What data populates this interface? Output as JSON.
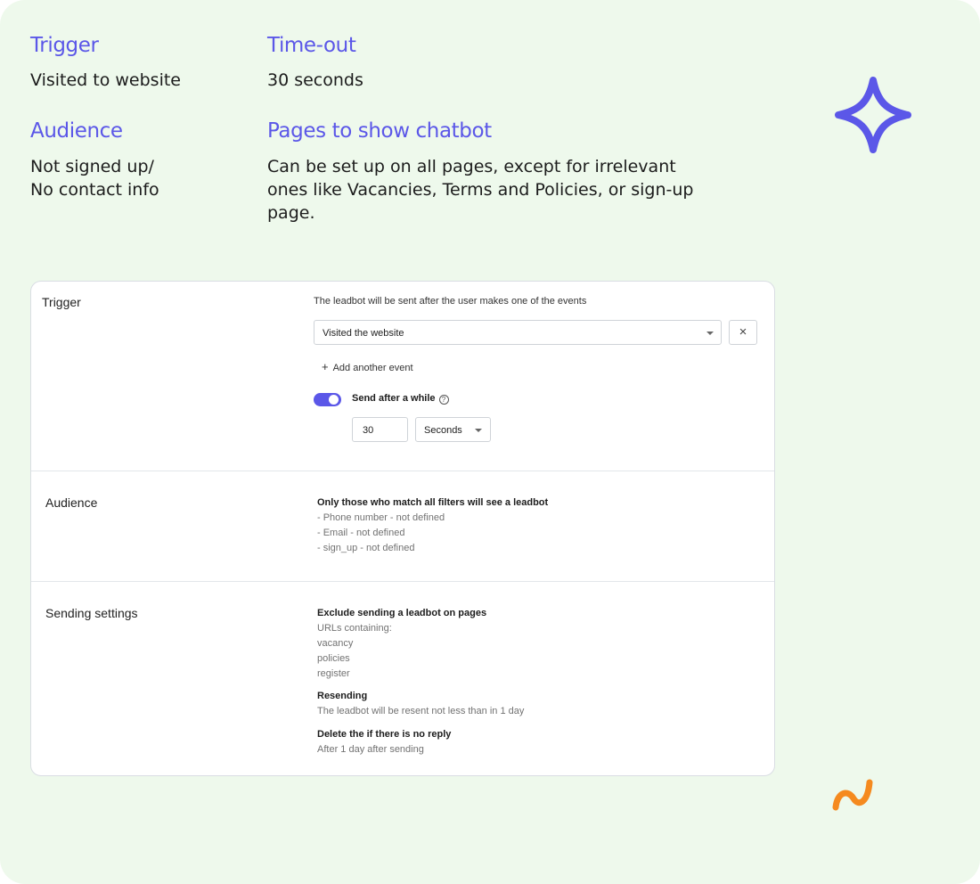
{
  "summary": {
    "trigger": {
      "heading": "Trigger",
      "value": "Visited to website"
    },
    "timeout": {
      "heading": "Time-out",
      "value": "30 seconds"
    },
    "audience": {
      "heading": "Audience",
      "value": "Not signed up/\nNo contact info"
    },
    "pages": {
      "heading": "Pages to show chatbot",
      "value": "Can be set up on all pages, except for irrelevant\nones like Vacancies, Terms and Policies, or sign-up\npage."
    }
  },
  "decor": {
    "sparkle_icon": "four-point-star-icon",
    "squiggle_icon": "squiggle-icon",
    "accent": "#5b57e8",
    "orange": "#f58a1f"
  },
  "card": {
    "trigger": {
      "label": "Trigger",
      "description": "The leadbot will be sent after the user makes one of the events",
      "event_value": "Visited the website",
      "remove_icon": "×",
      "add_event": "Add another event",
      "send_after_label": "Send after a while",
      "send_after_enabled": true,
      "delay_value": "30",
      "delay_unit": "Seconds"
    },
    "audience": {
      "label": "Audience",
      "title": "Only those who match all filters will see a leadbot",
      "filters": [
        "- Phone number - not defined",
        "- Email - not defined",
        "- sign_up - not defined"
      ]
    },
    "sending": {
      "label": "Sending settings",
      "exclude_title": "Exclude sending a leadbot on pages",
      "exclude_subtitle": "URLs containing:",
      "urls": [
        "vacancy",
        "policies",
        "register"
      ],
      "resend_title": "Resending",
      "resend_text": "The leadbot will be resent not less than in 1 day",
      "delete_title": "Delete the if there is no reply",
      "delete_text": "After 1 day after sending"
    }
  }
}
